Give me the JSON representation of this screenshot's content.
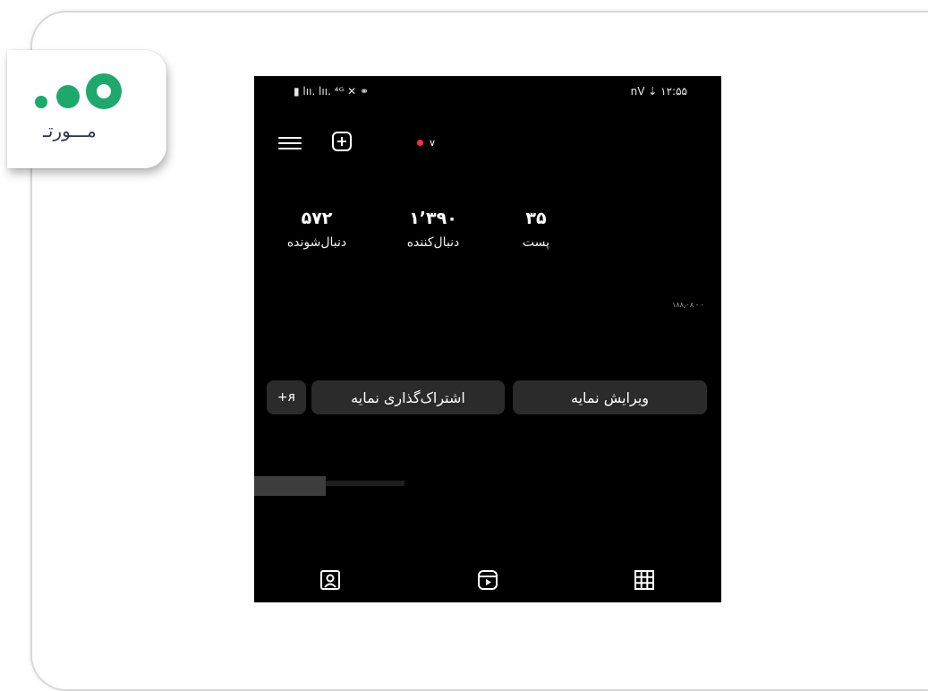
{
  "logo": {
    "text": "مـــورتـ"
  },
  "status_bar": {
    "left": "▮ lıı. lıı. ⁴ᴳ ✕ ⚭",
    "right": "nV ⇣ ۱۲:۵۵"
  },
  "profile": {
    "stats": [
      {
        "value": "۵۷۲",
        "label": "دنبال‌شونده"
      },
      {
        "value": "۱٬۳۹۰",
        "label": "دنبال‌کننده"
      },
      {
        "value": "۳۵",
        "label": "پست"
      }
    ],
    "faint_text": "۱۸۸٫۰۸ - -",
    "buttons": {
      "add_person": "+ᴙ",
      "share": "اشتراک‌گذاری نمایه",
      "edit": "ویرایش نمایه"
    }
  },
  "tabs": [
    "tagged-icon",
    "reels-icon",
    "grid-icon"
  ]
}
